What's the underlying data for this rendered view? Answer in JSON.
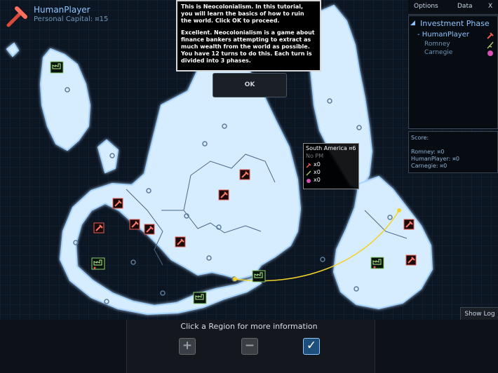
{
  "player": {
    "name": "HumanPlayer",
    "capital": "Personal Capital: ¤15"
  },
  "tutorial": {
    "paragraph1": "This is Neocolonialism. In this tutorial, you will learn the basics of how to ruin the world. Click OK to proceed.",
    "paragraph2": "Excellent. Neocolonialism is a game about finance bankers attempting to extract as much wealth from the world as possible. You have 12 turns to do this. Each turn is divided into 3 phases.",
    "ok_label": "OK"
  },
  "tabs": {
    "options": "Options",
    "data": "Data",
    "close": "X"
  },
  "phase": {
    "title": "Investment Phase",
    "players": [
      {
        "label": "- HumanPlayer",
        "color": "#e85a4f"
      },
      {
        "label": "Romney",
        "color": "#a5c35a"
      },
      {
        "label": "Carnegie",
        "color": "#d84fb6"
      }
    ]
  },
  "score": {
    "title": "Score:",
    "rows": [
      "Romney: ¤0",
      "HumanPlayer: ¤0",
      "Carnegie: ¤0"
    ]
  },
  "region_tip": {
    "title": "South America ¤6",
    "pm": "No PM",
    "counts": [
      "x0",
      "x0",
      "x0"
    ]
  },
  "bottom": {
    "hint": "Click a Region for more information",
    "plus": "+",
    "minus": "−",
    "check": "✓"
  },
  "show_log": "Show Log",
  "colors": {
    "land": "#d6ecff",
    "land_glow": "#9fd0ff",
    "ocean": "#0c1522",
    "route": "#f1d22b"
  }
}
